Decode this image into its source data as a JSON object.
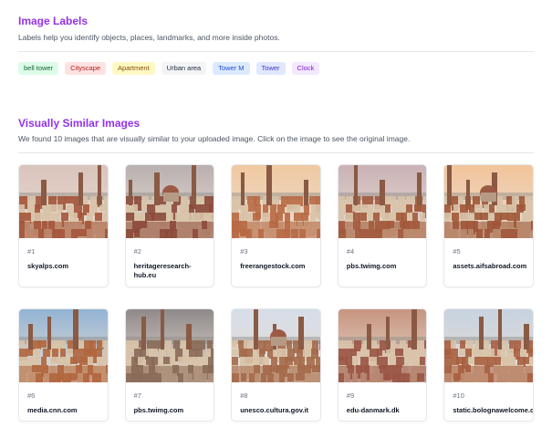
{
  "labels_section": {
    "title": "Image Labels",
    "description": "Labels help you identify objects, places, landmarks, and more inside photos.",
    "labels": [
      {
        "text": "bell tower",
        "bg": "#dcfce7",
        "fg": "#166534"
      },
      {
        "text": "Cityscape",
        "bg": "#fee2e2",
        "fg": "#b91c1c"
      },
      {
        "text": "Apartment",
        "bg": "#fef9c3",
        "fg": "#854d0e"
      },
      {
        "text": "Urban area",
        "bg": "#f3f4f6",
        "fg": "#1f2937"
      },
      {
        "text": "Tower M",
        "bg": "#dbeafe",
        "fg": "#1d4ed8"
      },
      {
        "text": "Tower",
        "bg": "#e0e7ff",
        "fg": "#4338ca"
      },
      {
        "text": "Clock",
        "bg": "#f3e8ff",
        "fg": "#7e22ce"
      }
    ]
  },
  "similar_section": {
    "title": "Visually Similar Images",
    "description": "We found 10 images that are visually similar to your uploaded image. Click on the image to see the original image.",
    "images": [
      {
        "index": "#1",
        "site": "skyalps.com"
      },
      {
        "index": "#2",
        "site": "heritageresearch-hub.eu"
      },
      {
        "index": "#3",
        "site": "freerangestock.com"
      },
      {
        "index": "#4",
        "site": "pbs.twimg.com"
      },
      {
        "index": "#5",
        "site": "assets.aifsabroad.com"
      },
      {
        "index": "#6",
        "site": "media.cnn.com"
      },
      {
        "index": "#7",
        "site": "pbs.twimg.com"
      },
      {
        "index": "#8",
        "site": "unesco.cultura.gov.it"
      },
      {
        "index": "#9",
        "site": "edu-danmark.dk"
      },
      {
        "index": "#10",
        "site": "static.bolognawelcome.co..."
      }
    ]
  },
  "colors": {
    "accent": "#9333ea",
    "sky": [
      "#d9c4bc",
      "#b9b0b0",
      "#f0c9a0",
      "#c9b2b6",
      "#f2c49a",
      "#93b4d4",
      "#8f8a8a",
      "#d6dde8",
      "#c79580",
      "#c7d3e0"
    ],
    "roofs": [
      "#a4553a",
      "#8c4a3a",
      "#b86a45",
      "#a35a3c",
      "#9e5638",
      "#b0663e",
      "#8a6a58",
      "#a46a4a",
      "#9a5545",
      "#a85f40"
    ]
  }
}
